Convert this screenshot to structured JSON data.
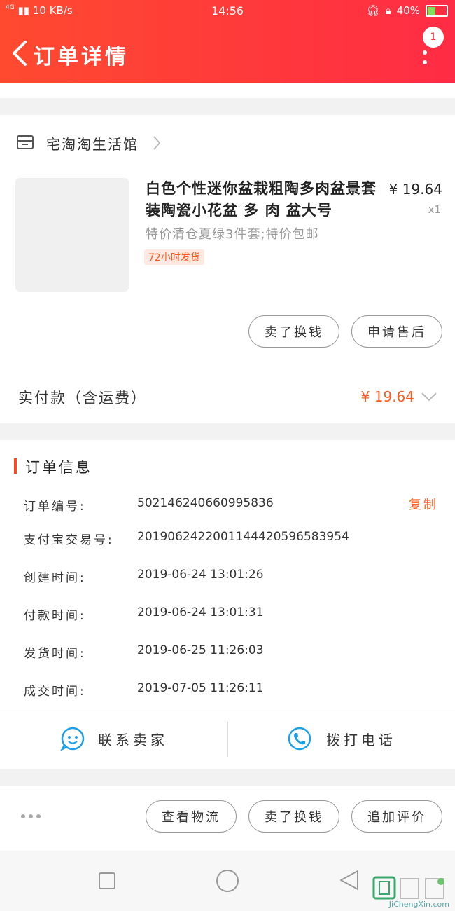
{
  "status_bar": {
    "network": "4G",
    "speed": "10 KB/s",
    "time": "14:56",
    "battery": "40%"
  },
  "header": {
    "title": "订单详情",
    "badge_count": "1"
  },
  "store": {
    "name": "宅淘淘生活馆"
  },
  "product": {
    "title": "白色个性迷你盆栽粗陶多肉盆景套装陶瓷小花盆 多 肉 盆大号",
    "price": "¥ 19.64",
    "quantity": "x1",
    "sku": "特价清仓夏绿3件套;特价包邮",
    "tag": "72小时发货"
  },
  "item_actions": {
    "exchange": "卖了换钱",
    "after_sale": "申请售后"
  },
  "payment": {
    "label": "实付款（含运费）",
    "amount": "¥ 19.64"
  },
  "order_info": {
    "title": "订单信息",
    "copy_label": "复制",
    "rows": [
      {
        "label": "订单编号:",
        "value": "502146240660995836"
      },
      {
        "label": "支付宝交易号:",
        "value": "2019062422001144420596583954"
      },
      {
        "label": "创建时间:",
        "value": "2019-06-24 13:01:26"
      },
      {
        "label": "付款时间:",
        "value": "2019-06-24 13:01:31"
      },
      {
        "label": "发货时间:",
        "value": "2019-06-25 11:26:03"
      },
      {
        "label": "成交时间:",
        "value": "2019-07-05 11:26:11"
      }
    ]
  },
  "contact": {
    "seller": "联系卖家",
    "call": "拨打电话"
  },
  "bottom_actions": {
    "logistics": "查看物流",
    "exchange": "卖了换钱",
    "review": "追加评价"
  },
  "watermark": {
    "text": "JiChengXin.com"
  },
  "colors": {
    "header": "#ff3a3a",
    "accent": "#ff5a1f",
    "icon_blue": "#1ea0e6"
  }
}
